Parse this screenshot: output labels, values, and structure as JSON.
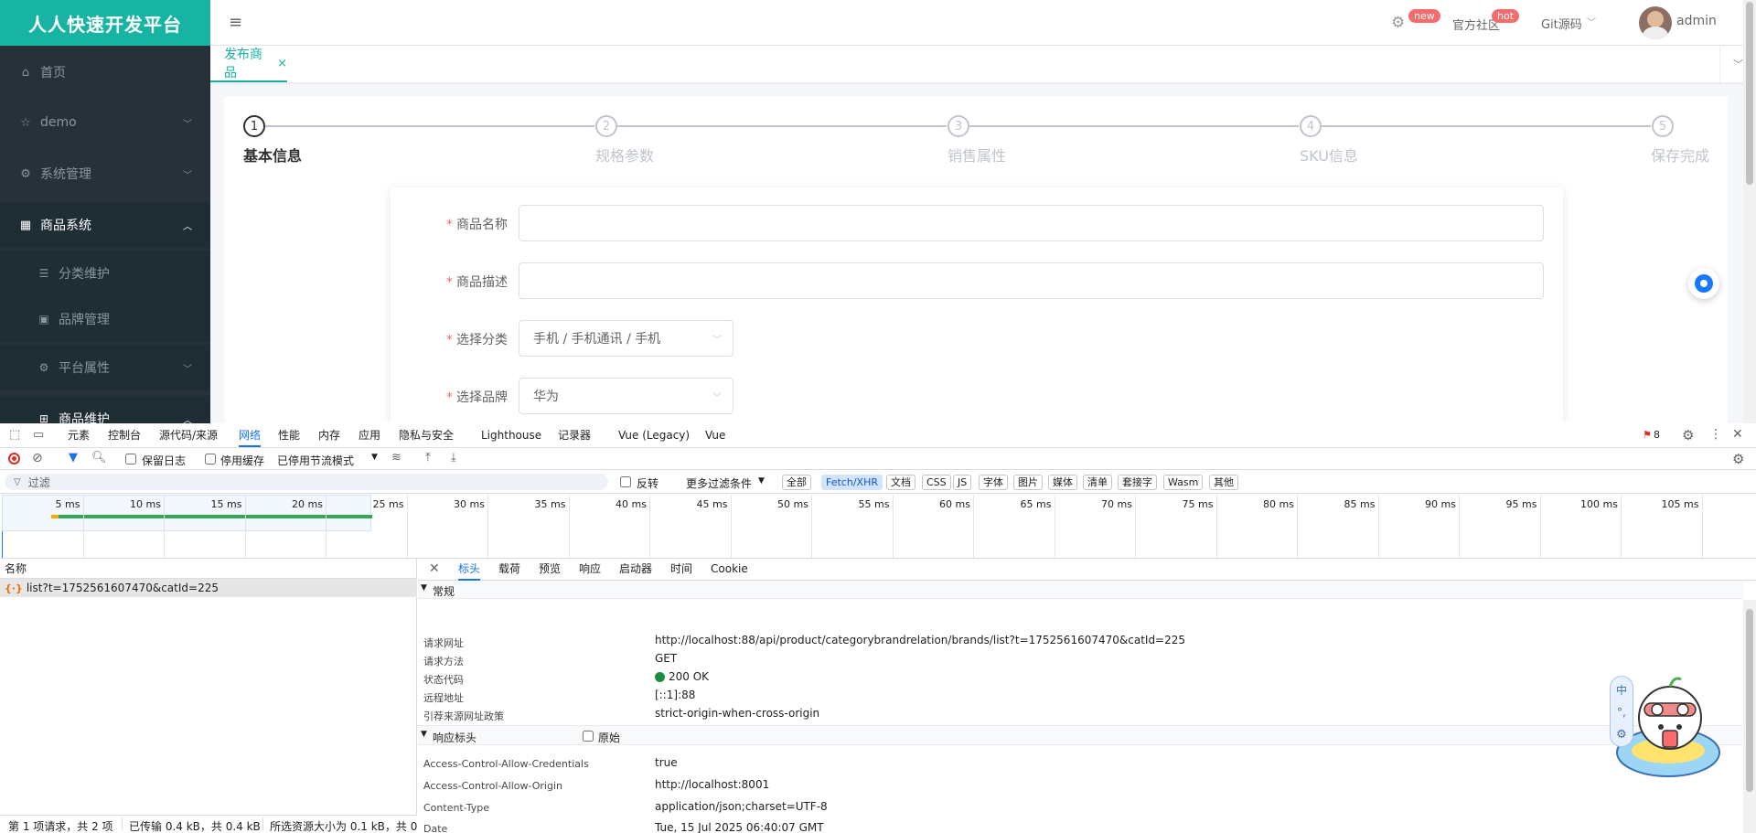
{
  "app": {
    "brand": "人人快速开发平台",
    "colors": {
      "brand_bg": "#17b3a3",
      "sidebar_bg": "#263238",
      "accent": "#17b3a3",
      "required": "#f56c6c"
    },
    "sidebar": {
      "items": [
        {
          "label": "首页",
          "icon": "home-icon"
        },
        {
          "label": "demo",
          "icon": "star-icon"
        },
        {
          "label": "系统管理",
          "icon": "gear-icon"
        },
        {
          "label": "商品系统",
          "icon": "product-icon"
        },
        {
          "label": "分类维护",
          "icon": "list-icon"
        },
        {
          "label": "品牌管理",
          "icon": "brand-icon"
        },
        {
          "label": "平台属性",
          "icon": "gear-icon"
        },
        {
          "label": "商品维护",
          "icon": "grid-icon"
        }
      ]
    },
    "header": {
      "new_badge": "new",
      "hot_badge": "hot",
      "community_label": "官方社区",
      "git_label": "Git源码",
      "user_name": "admin"
    },
    "tabs": [
      {
        "label": "发布商品",
        "close": "×"
      }
    ],
    "steps": [
      {
        "num": "1",
        "title": "基本信息"
      },
      {
        "num": "2",
        "title": "规格参数"
      },
      {
        "num": "3",
        "title": "销售属性"
      },
      {
        "num": "4",
        "title": "SKU信息"
      },
      {
        "num": "5",
        "title": "保存完成"
      }
    ],
    "form": {
      "name_label": "商品名称",
      "desc_label": "商品描述",
      "category_label": "选择分类",
      "category_value": "手机 / 手机通讯 / 手机",
      "brand_label": "选择品牌",
      "brand_value": "华为",
      "required_mark": "*"
    }
  },
  "devtools": {
    "tabs": [
      "元素",
      "控制台",
      "源代码/来源",
      "网络",
      "性能",
      "内存",
      "应用",
      "隐私与安全",
      "Lighthouse",
      "记录器",
      "Vue (Legacy)",
      "Vue"
    ],
    "active_tab": "网络",
    "issues_count": "8",
    "toolbar": {
      "preserve_log": "保留日志",
      "disable_cache": "停用缓存",
      "throttle": "已停用节流模式"
    },
    "filter": {
      "placeholder": "过滤",
      "invert": "反转",
      "more_filters": "更多过滤条件",
      "chips": [
        "全部",
        "Fetch/XHR",
        "文档",
        "CSS",
        "JS",
        "字体",
        "图片",
        "媒体",
        "清单",
        "套接字",
        "Wasm",
        "其他"
      ],
      "active_chip": "Fetch/XHR"
    },
    "timeline_ticks": [
      "5 ms",
      "10 ms",
      "15 ms",
      "20 ms",
      "25 ms",
      "30 ms",
      "35 ms",
      "40 ms",
      "45 ms",
      "50 ms",
      "55 ms",
      "60 ms",
      "65 ms",
      "70 ms",
      "75 ms",
      "80 ms",
      "85 ms",
      "90 ms",
      "95 ms",
      "100 ms",
      "105 ms"
    ],
    "request_list": {
      "header": "名称",
      "rows": [
        {
          "name": "list?t=1752561607470&catId=225"
        }
      ]
    },
    "detail_tabs": [
      "标头",
      "载荷",
      "预览",
      "响应",
      "启动器",
      "时间",
      "Cookie"
    ],
    "general": {
      "title": "常规",
      "rows": [
        {
          "name": "请求网址",
          "value": "http://localhost:88/api/product/categorybrandrelation/brands/list?t=1752561607470&catId=225"
        },
        {
          "name": "请求方法",
          "value": "GET"
        },
        {
          "name": "状态代码",
          "value": "200 OK"
        },
        {
          "name": "远程地址",
          "value": "[::1]:88"
        },
        {
          "name": "引荐来源网址政策",
          "value": "strict-origin-when-cross-origin"
        }
      ]
    },
    "response_headers": {
      "title": "响应标头",
      "raw_label": "原始",
      "rows": [
        {
          "name": "Access-Control-Allow-Credentials",
          "value": "true"
        },
        {
          "name": "Access-Control-Allow-Origin",
          "value": "http://localhost:8001"
        },
        {
          "name": "Content-Type",
          "value": "application/json;charset=UTF-8"
        },
        {
          "name": "Date",
          "value": "Tue, 15 Jul 2025 06:40:07 GMT"
        }
      ]
    },
    "status_bar": {
      "requests": "第 1 项请求，共 2 项",
      "transferred": "已传输 0.4 kB，共 0.4 kB",
      "resources": "所选资源大小为 0.1 kB，共 0"
    }
  }
}
